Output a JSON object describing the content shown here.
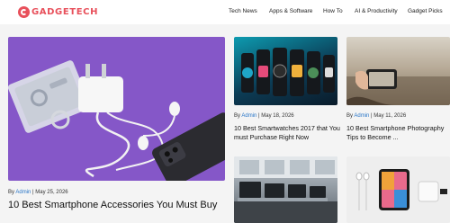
{
  "header": {
    "logo_text": "GADGETECH",
    "nav": [
      "Tech News",
      "Apps & Software",
      "How To",
      "AI & Productivity",
      "Gadget Picks"
    ]
  },
  "featured": {
    "by": "By",
    "author": "Admin",
    "date": "May 25, 2026",
    "title": "10 Best Smartphone Accessories You Must Buy"
  },
  "cards": [
    {
      "by": "By",
      "author": "Admin",
      "date": "May 18, 2026",
      "title": "10 Best Smartwatches 2017 that You must Purchase Right Now"
    },
    {
      "by": "By",
      "author": "Admin",
      "date": "May 11, 2026",
      "title": "10 Best Smartphone Photography Tips to Become ..."
    }
  ],
  "colors": {
    "brand": "#e8505b",
    "link": "#2a76c7",
    "featured_bg": "#8557c8"
  },
  "icons": {
    "logo": "gadgetech-logo-icon"
  }
}
